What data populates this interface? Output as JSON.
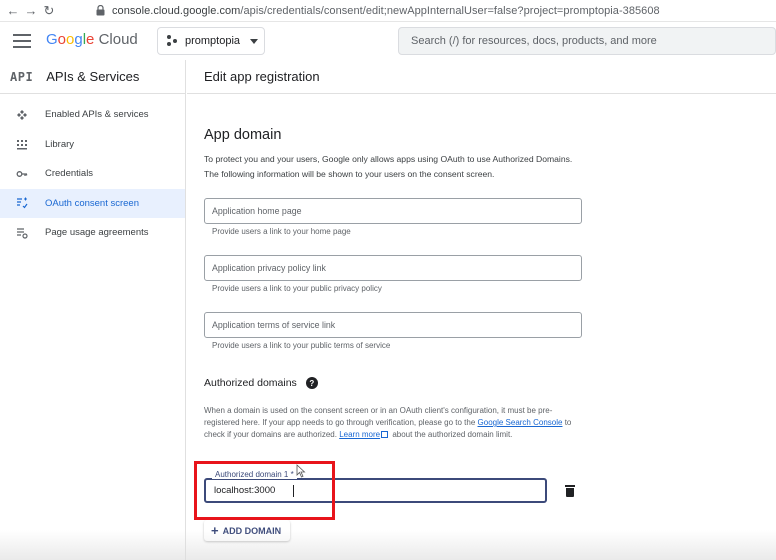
{
  "browser": {
    "url_host": "console.cloud.google.com",
    "url_rest": "/apis/credentials/consent/edit;newAppInternalUser=false?project=promptopia-385608"
  },
  "header": {
    "logo_google": [
      "G",
      "o",
      "o",
      "g",
      "l",
      "e"
    ],
    "logo_cloud": "Cloud",
    "project": "promptopia",
    "search_placeholder": "Search (/) for resources, docs, products, and more"
  },
  "sidebar": {
    "badge": "API",
    "title": "APIs & Services",
    "items": [
      {
        "label": "Enabled APIs & services",
        "icon": "api-icon",
        "active": false
      },
      {
        "label": "Library",
        "icon": "library-icon",
        "active": false
      },
      {
        "label": "Credentials",
        "icon": "key-icon",
        "active": false
      },
      {
        "label": "OAuth consent screen",
        "icon": "consent-icon",
        "active": true
      },
      {
        "label": "Page usage agreements",
        "icon": "settings-list-icon",
        "active": false
      }
    ]
  },
  "main": {
    "page_title": "Edit app registration",
    "section_title": "App domain",
    "section_desc": "To protect you and your users, Google only allows apps using OAuth to use Authorized Domains. The following information will be shown to your users on the consent screen.",
    "fields": [
      {
        "placeholder": "Application home page",
        "hint": "Provide users a link to your home page"
      },
      {
        "placeholder": "Application privacy policy link",
        "hint": "Provide users a link to your public privacy policy"
      },
      {
        "placeholder": "Application terms of service link",
        "hint": "Provide users a link to your public terms of service"
      }
    ],
    "authorized": {
      "title": "Authorized domains",
      "help": "?",
      "desc_1": "When a domain is used on the consent screen or in an OAuth client's configuration, it must be pre-registered here. If your app needs to go through verification, please go to the ",
      "link_search_console": "Google Search Console",
      "desc_2": " to check if your domains are authorized. ",
      "link_learn_more": "Learn more",
      "desc_3": " about the authorized domain limit.",
      "domain_label": "Authorized domain 1 *",
      "domain_value": "localhost:3000",
      "add_button": "ADD DOMAIN"
    }
  },
  "colors": {
    "accent": "#1967d2",
    "active_nav_bg": "#e8f0fe",
    "highlight": "#e8141b"
  }
}
